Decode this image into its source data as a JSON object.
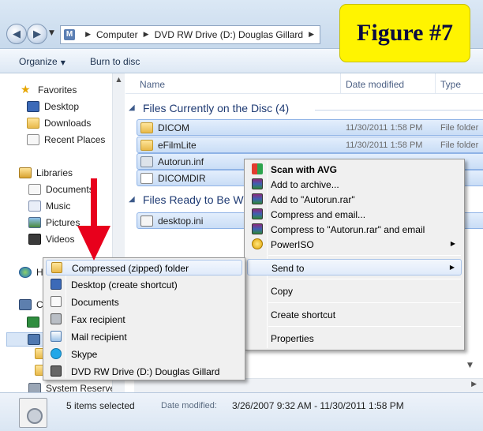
{
  "address": {
    "crumbs": [
      "Computer",
      "DVD RW Drive (D:) Douglas Gillard"
    ]
  },
  "figure_label": "Figure #7",
  "toolbar": {
    "organize_label": "Organize",
    "burn_label": "Burn to disc"
  },
  "nav": {
    "favorites": "Favorites",
    "desktop": "Desktop",
    "downloads": "Downloads",
    "recent_places": "Recent Places",
    "libraries": "Libraries",
    "documents": "Documents",
    "music": "Music",
    "pictures": "Pictures",
    "videos": "Videos",
    "homegroup_partial": "H",
    "computer_partial": "C",
    "system_reserved": "System Reserved"
  },
  "columns": {
    "name": "Name",
    "date_modified": "Date modified",
    "type": "Type"
  },
  "groups": {
    "on_disc": "Files Currently on the Disc (4)",
    "ready": "Files Ready to Be W"
  },
  "files_on_disc": [
    {
      "name": "DICOM",
      "date": "11/30/2011 1:58 PM",
      "type": "File folder"
    },
    {
      "name": "eFilmLite",
      "date": "11/30/2011 1:58 PM",
      "type": "File folder"
    },
    {
      "name": "Autorun.inf",
      "date": "",
      "type": ""
    },
    {
      "name": "DICOMDIR",
      "date": "",
      "type": ""
    }
  ],
  "files_ready": [
    {
      "name": "desktop.ini"
    }
  ],
  "context_menu": {
    "scan_avg": "Scan with AVG",
    "add_archive": "Add to archive...",
    "add_rar": "Add to \"Autorun.rar\"",
    "compress_email": "Compress and email...",
    "compress_rar_email": "Compress to \"Autorun.rar\" and email",
    "poweriso": "PowerISO",
    "send_to": "Send to",
    "copy": "Copy",
    "create_shortcut": "Create shortcut",
    "properties": "Properties"
  },
  "send_to_menu": [
    "Compressed (zipped) folder",
    "Desktop (create shortcut)",
    "Documents",
    "Fax recipient",
    "Mail recipient",
    "Skype",
    "DVD RW Drive (D:) Douglas Gillard"
  ],
  "status": {
    "count": "5 items selected",
    "date_label": "Date modified:",
    "date_value": "3/26/2007 9:32 AM - 11/30/2011 1:58 PM"
  },
  "colors": {
    "figure_label_bg": "#fff400",
    "annotation_arrow": "#e8001c",
    "group_header": "#1e3a73"
  }
}
